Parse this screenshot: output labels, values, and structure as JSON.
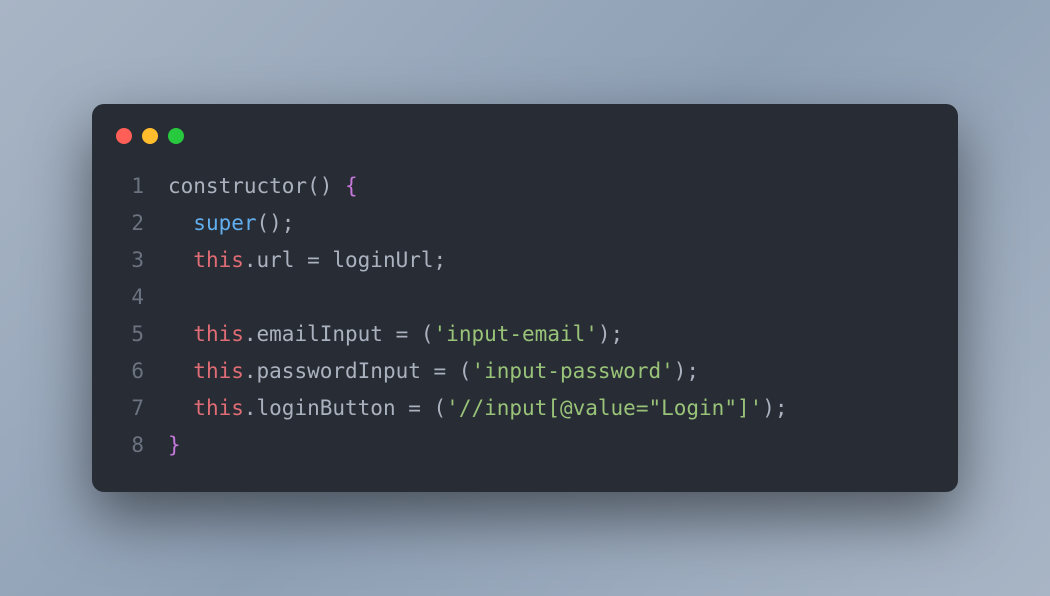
{
  "window": {
    "controls": [
      "close",
      "minimize",
      "maximize"
    ]
  },
  "code": {
    "lines": [
      {
        "number": "1",
        "tokens": [
          {
            "text": "constructor",
            "class": "tok-constructor"
          },
          {
            "text": "() ",
            "class": "tok-punct"
          },
          {
            "text": "{",
            "class": "tok-brace"
          }
        ]
      },
      {
        "number": "2",
        "tokens": [
          {
            "text": "  ",
            "class": "tok-default"
          },
          {
            "text": "super",
            "class": "tok-super"
          },
          {
            "text": "();",
            "class": "tok-punct"
          }
        ]
      },
      {
        "number": "3",
        "tokens": [
          {
            "text": "  ",
            "class": "tok-default"
          },
          {
            "text": "this",
            "class": "tok-this"
          },
          {
            "text": ".url = loginUrl;",
            "class": "tok-prop"
          }
        ]
      },
      {
        "number": "4",
        "tokens": []
      },
      {
        "number": "5",
        "tokens": [
          {
            "text": "  ",
            "class": "tok-default"
          },
          {
            "text": "this",
            "class": "tok-this"
          },
          {
            "text": ".emailInput = (",
            "class": "tok-prop"
          },
          {
            "text": "'input-email'",
            "class": "tok-string"
          },
          {
            "text": ");",
            "class": "tok-punct"
          }
        ]
      },
      {
        "number": "6",
        "tokens": [
          {
            "text": "  ",
            "class": "tok-default"
          },
          {
            "text": "this",
            "class": "tok-this"
          },
          {
            "text": ".passwordInput = (",
            "class": "tok-prop"
          },
          {
            "text": "'input-password'",
            "class": "tok-string"
          },
          {
            "text": ");",
            "class": "tok-punct"
          }
        ]
      },
      {
        "number": "7",
        "tokens": [
          {
            "text": "  ",
            "class": "tok-default"
          },
          {
            "text": "this",
            "class": "tok-this"
          },
          {
            "text": ".loginButton = (",
            "class": "tok-prop"
          },
          {
            "text": "'//input[@value=\"Login\"]'",
            "class": "tok-string"
          },
          {
            "text": ");",
            "class": "tok-punct"
          }
        ]
      },
      {
        "number": "8",
        "tokens": [
          {
            "text": "}",
            "class": "tok-brace"
          }
        ]
      }
    ]
  }
}
